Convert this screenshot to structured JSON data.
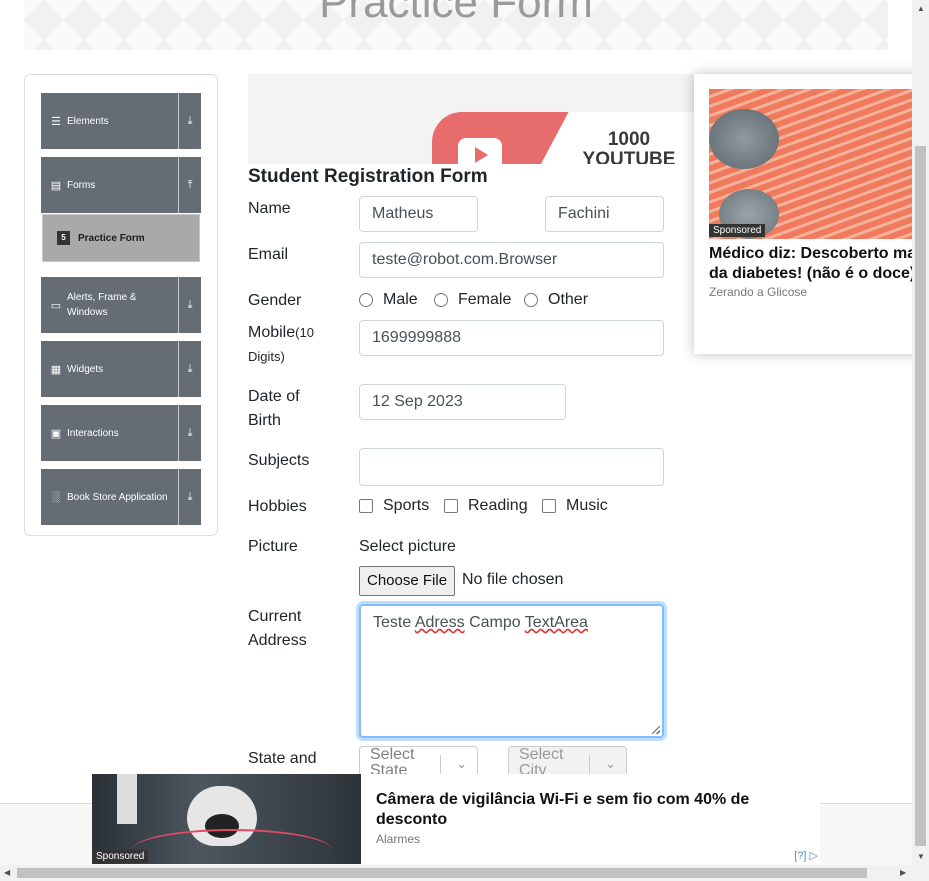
{
  "page": {
    "title": "Practice Form"
  },
  "sidebar": {
    "groups": [
      {
        "label": "Elements",
        "icon": "hamburger-icon",
        "arrow": "download-arrow-icon"
      },
      {
        "label": "Forms",
        "icon": "document-icon",
        "arrow": "upload-arrow-icon"
      },
      {
        "label": "Alerts, Frame & Windows",
        "icon": "window-icon",
        "arrow": "download-arrow-icon"
      },
      {
        "label": "Widgets",
        "icon": "grid-icon",
        "arrow": "download-arrow-icon"
      },
      {
        "label": "Interactions",
        "icon": "interaction-icon",
        "arrow": "download-arrow-icon"
      },
      {
        "label": "Book Store Application",
        "icon": "books-icon",
        "arrow": "download-arrow-icon"
      }
    ],
    "active_item": {
      "label": "Practice Form",
      "icon": "html5-icon"
    }
  },
  "top_ad": {
    "text_line1": "1000",
    "text_line2": "YOUTUBE VIEWS"
  },
  "form": {
    "title": "Student Registration Form",
    "name_label": "Name",
    "first_name": "Matheus",
    "last_name": "Fachini",
    "email_label": "Email",
    "email": "teste@robot.com.Browser",
    "gender_label": "Gender",
    "gender_options": [
      "Male",
      "Female",
      "Other"
    ],
    "mobile_label": "Mobile",
    "mobile_hint_1": "(10",
    "mobile_hint_2": "Digits)",
    "mobile": "1699999888",
    "dob_label_1": "Date of",
    "dob_label_2": "Birth",
    "dob": "12 Sep 2023",
    "subjects_label": "Subjects",
    "subjects": "",
    "hobbies_label": "Hobbies",
    "hobbies": [
      "Sports",
      "Reading",
      "Music"
    ],
    "picture_label": "Picture",
    "picture_prompt": "Select picture",
    "file_button": "Choose File",
    "file_status": "No file chosen",
    "address_label_1": "Current",
    "address_label_2": "Address",
    "address_words": [
      "Teste",
      "Adress",
      "Campo",
      "TextArea"
    ],
    "state_city_label": "State and",
    "state_placeholder_1": "Select",
    "state_placeholder_2": "State",
    "city_placeholder_1": "Select",
    "city_placeholder_2": "City"
  },
  "right_ad": {
    "badge": "Sponsored",
    "headline": "Médico diz: Descoberto ma da diabetes! (não é o doce)",
    "headline_line1": "Médico diz: Descoberto ma",
    "headline_line2": "da diabetes! (não é o doce)",
    "source": "Zerando a Glicose"
  },
  "bottom_ad": {
    "badge": "Sponsored",
    "headline": "Câmera de vigilância Wi-Fi e sem fio com 40% de desconto",
    "source": "Alarmes",
    "adchoices": "[?]"
  }
}
